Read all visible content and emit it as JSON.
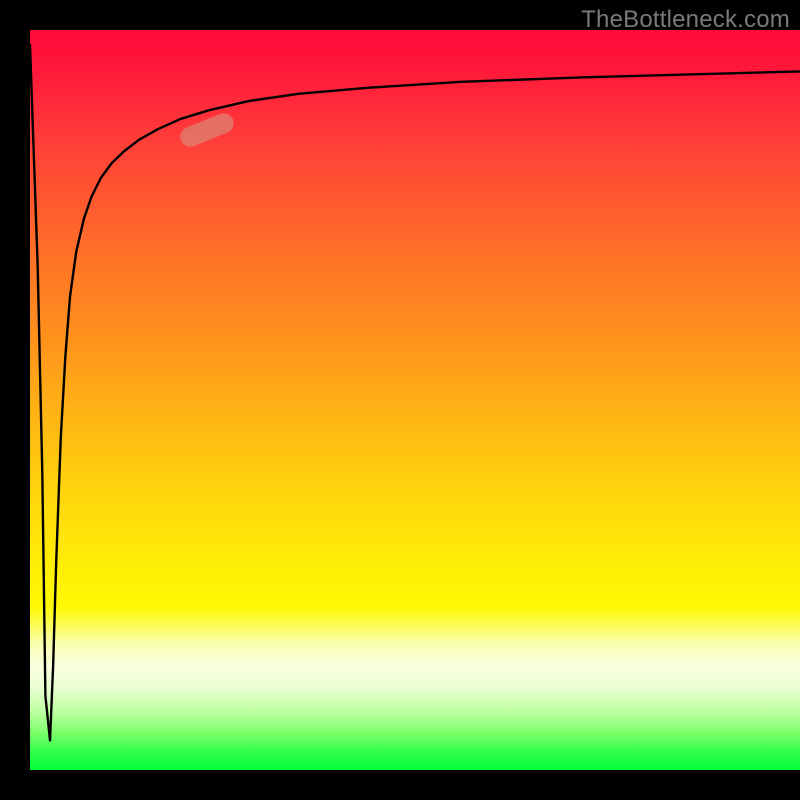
{
  "watermark": {
    "text": "TheBottleneck.com"
  },
  "colors": {
    "frame_bg": "#000000",
    "curve_stroke": "#000000",
    "marker_fill": "rgba(214,148,128,0.60)",
    "watermark_color": "#7a7a7a",
    "gradient_stops": [
      "#ff0a3a",
      "#ff3a3a",
      "#ff7626",
      "#ffb414",
      "#ffee06",
      "#faffe0",
      "#7cff6a",
      "#00ff3a"
    ]
  },
  "chart_data": {
    "type": "line",
    "title": "",
    "xlabel": "",
    "ylabel": "",
    "xlim": [
      0,
      100
    ],
    "ylim": [
      0,
      100
    ],
    "grid": false,
    "legend": false,
    "series": [
      {
        "name": "bottleneck-curve",
        "x": [
          0.0,
          1.0,
          1.6,
          2.0,
          2.6,
          3.0,
          3.4,
          4.0,
          4.6,
          5.2,
          6.0,
          7.0,
          8.0,
          9.2,
          10.6,
          12.2,
          14.2,
          16.6,
          19.6,
          23.4,
          28.4,
          35.0,
          44.0,
          56.0,
          72.0,
          100.0
        ],
        "y": [
          98.0,
          68.0,
          40.0,
          10.0,
          4.0,
          14.0,
          28.0,
          45.0,
          56.0,
          64.0,
          70.0,
          74.5,
          77.5,
          80.0,
          82.0,
          83.6,
          85.2,
          86.6,
          88.0,
          89.2,
          90.4,
          91.4,
          92.2,
          93.0,
          93.6,
          94.4
        ]
      }
    ],
    "marker": {
      "center_x_pct": 23.0,
      "center_y_pct": 86.5,
      "angle_deg": -22
    },
    "background_gradient": {
      "direction": "top-to-bottom",
      "top_color": "#ff0a3a",
      "bottom_color": "#00ff3a"
    }
  }
}
